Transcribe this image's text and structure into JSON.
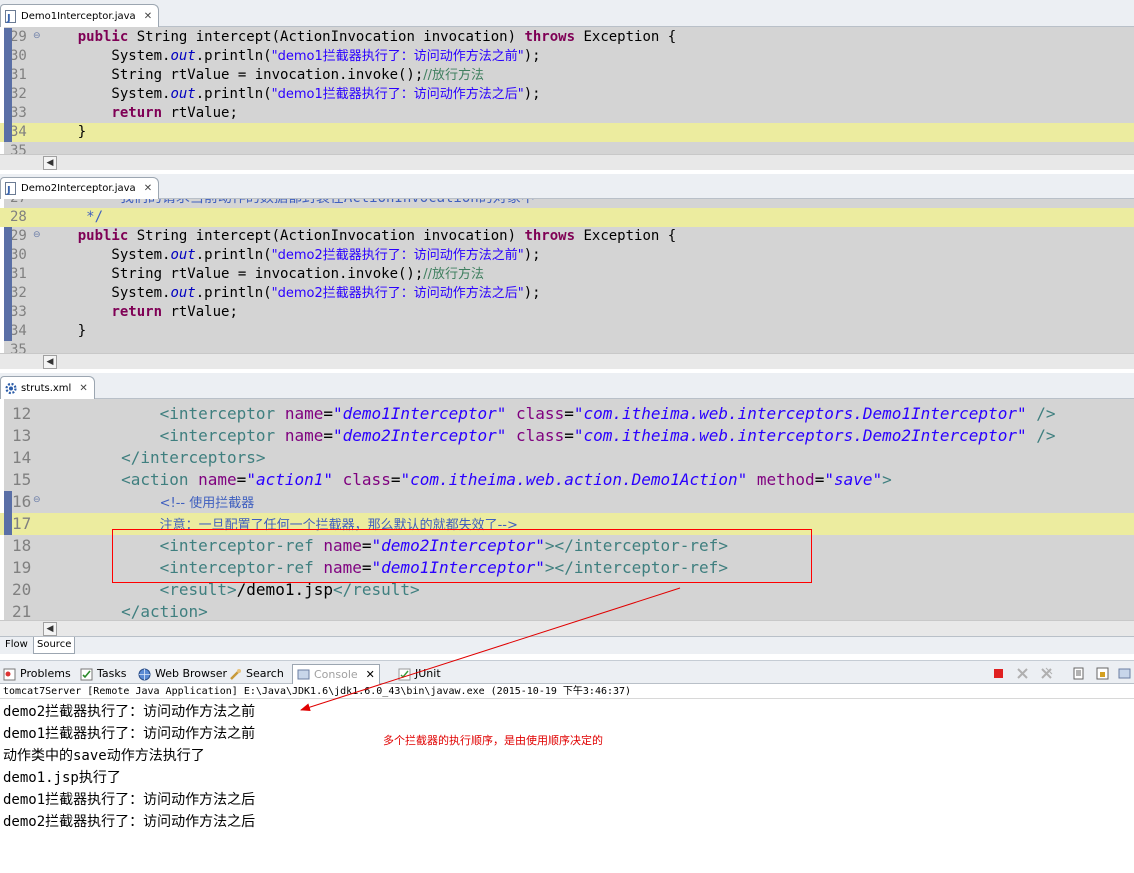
{
  "pane1": {
    "tab_label": "Demo1Interceptor.java",
    "lines": [
      {
        "n": "29",
        "segs": [
          [
            "p",
            "    "
          ],
          [
            "kw",
            "public"
          ],
          [
            "p",
            " String intercept(ActionInvocation invocation) "
          ],
          [
            "kw",
            "throws"
          ],
          [
            "p",
            " Exception {"
          ]
        ]
      },
      {
        "n": "30",
        "segs": [
          [
            "p",
            "        System."
          ],
          [
            "fld",
            "out"
          ],
          [
            "p",
            ".println("
          ],
          [
            "str",
            "\"demo1拦截器执行了：访问动作方法之前\""
          ],
          [
            "p",
            ");"
          ]
        ]
      },
      {
        "n": "31",
        "segs": [
          [
            "p",
            "        String rtValue = invocation.invoke();"
          ],
          [
            "cm",
            "//放行方法"
          ]
        ]
      },
      {
        "n": "32",
        "segs": [
          [
            "p",
            "        System."
          ],
          [
            "fld",
            "out"
          ],
          [
            "p",
            ".println("
          ],
          [
            "str",
            "\"demo1拦截器执行了：访问动作方法之后\""
          ],
          [
            "p",
            ");"
          ]
        ]
      },
      {
        "n": "33",
        "segs": [
          [
            "p",
            "        "
          ],
          [
            "kw",
            "return"
          ],
          [
            "p",
            " rtValue;"
          ]
        ]
      },
      {
        "n": "34",
        "segs": [
          [
            "p",
            "    }"
          ]
        ]
      },
      {
        "n": "35",
        "segs": [
          [
            "p",
            ""
          ]
        ]
      }
    ]
  },
  "pane2": {
    "tab_label": "Demo2Interceptor.java",
    "lines": [
      {
        "n": "27",
        "segs": [
          [
            "jd",
            "       * 我们的请求当前动作的数据都封装在ActionInvocation的对象中"
          ]
        ]
      },
      {
        "n": "28",
        "segs": [
          [
            "jd",
            "     */"
          ]
        ]
      },
      {
        "n": "29",
        "segs": [
          [
            "p",
            "    "
          ],
          [
            "kw",
            "public"
          ],
          [
            "p",
            " String intercept(ActionInvocation invocation) "
          ],
          [
            "kw",
            "throws"
          ],
          [
            "p",
            " Exception {"
          ]
        ]
      },
      {
        "n": "30",
        "segs": [
          [
            "p",
            "        System."
          ],
          [
            "fld",
            "out"
          ],
          [
            "p",
            ".println("
          ],
          [
            "str",
            "\"demo2拦截器执行了：访问动作方法之前\""
          ],
          [
            "p",
            ");"
          ]
        ]
      },
      {
        "n": "31",
        "segs": [
          [
            "p",
            "        String rtValue = invocation.invoke();"
          ],
          [
            "cm",
            "//放行方法"
          ]
        ]
      },
      {
        "n": "32",
        "segs": [
          [
            "p",
            "        System."
          ],
          [
            "fld",
            "out"
          ],
          [
            "p",
            ".println("
          ],
          [
            "str",
            "\"demo2拦截器执行了：访问动作方法之后\""
          ],
          [
            "p",
            ");"
          ]
        ]
      },
      {
        "n": "33",
        "segs": [
          [
            "p",
            "        "
          ],
          [
            "kw",
            "return"
          ],
          [
            "p",
            " rtValue;"
          ]
        ]
      },
      {
        "n": "34",
        "segs": [
          [
            "p",
            "    }"
          ]
        ]
      },
      {
        "n": "35",
        "segs": [
          [
            "p",
            ""
          ]
        ]
      }
    ]
  },
  "pane3": {
    "tab_label": "struts.xml",
    "lines": [
      {
        "n": "12",
        "segs": [
          [
            "p",
            "            "
          ],
          [
            "tag",
            "<interceptor"
          ],
          [
            "p",
            " "
          ],
          [
            "attr",
            "name"
          ],
          [
            "p",
            "="
          ],
          [
            "aval",
            "\"demo1Interceptor\""
          ],
          [
            "p",
            " "
          ],
          [
            "attr",
            "class"
          ],
          [
            "p",
            "="
          ],
          [
            "aval",
            "\"com.itheima.web.interceptors.Demo1Interceptor\""
          ],
          [
            "p",
            " "
          ],
          [
            "tag",
            "/>"
          ]
        ]
      },
      {
        "n": "13",
        "segs": [
          [
            "p",
            "            "
          ],
          [
            "tag",
            "<interceptor"
          ],
          [
            "p",
            " "
          ],
          [
            "attr",
            "name"
          ],
          [
            "p",
            "="
          ],
          [
            "aval",
            "\"demo2Interceptor\""
          ],
          [
            "p",
            " "
          ],
          [
            "attr",
            "class"
          ],
          [
            "p",
            "="
          ],
          [
            "aval",
            "\"com.itheima.web.interceptors.Demo2Interceptor\""
          ],
          [
            "p",
            " "
          ],
          [
            "tag",
            "/>"
          ]
        ]
      },
      {
        "n": "14",
        "segs": [
          [
            "p",
            "        "
          ],
          [
            "tag",
            "</interceptors>"
          ]
        ]
      },
      {
        "n": "15",
        "segs": [
          [
            "p",
            "        "
          ],
          [
            "tag",
            "<action"
          ],
          [
            "p",
            " "
          ],
          [
            "attr",
            "name"
          ],
          [
            "p",
            "="
          ],
          [
            "aval",
            "\"action1\""
          ],
          [
            "p",
            " "
          ],
          [
            "attr",
            "class"
          ],
          [
            "p",
            "="
          ],
          [
            "aval",
            "\"com.itheima.web.action.Demo1Action\""
          ],
          [
            "p",
            " "
          ],
          [
            "attr",
            "method"
          ],
          [
            "p",
            "="
          ],
          [
            "aval",
            "\"save\""
          ],
          [
            "tag",
            ">"
          ]
        ]
      },
      {
        "n": "16",
        "segs": [
          [
            "p",
            "            "
          ],
          [
            "xcm",
            "<!-- 使用拦截器"
          ]
        ]
      },
      {
        "n": "17",
        "segs": [
          [
            "p",
            "            "
          ],
          [
            "xcm",
            "注意：一旦配置了任何一个拦截器，那么默认的就都失效了-->"
          ]
        ]
      },
      {
        "n": "18",
        "segs": [
          [
            "p",
            "            "
          ],
          [
            "tag",
            "<interceptor-ref"
          ],
          [
            "p",
            " "
          ],
          [
            "attr",
            "name"
          ],
          [
            "p",
            "="
          ],
          [
            "aval",
            "\"demo2Interceptor\""
          ],
          [
            "tag",
            "></interceptor-ref>"
          ]
        ]
      },
      {
        "n": "19",
        "segs": [
          [
            "p",
            "            "
          ],
          [
            "tag",
            "<interceptor-ref"
          ],
          [
            "p",
            " "
          ],
          [
            "attr",
            "name"
          ],
          [
            "p",
            "="
          ],
          [
            "aval",
            "\"demo1Interceptor\""
          ],
          [
            "tag",
            "></interceptor-ref>"
          ]
        ]
      },
      {
        "n": "20",
        "segs": [
          [
            "p",
            "            "
          ],
          [
            "tag",
            "<result>"
          ],
          [
            "p",
            "/demo1.jsp"
          ],
          [
            "tag",
            "</result>"
          ]
        ]
      },
      {
        "n": "21",
        "segs": [
          [
            "p",
            "        "
          ],
          [
            "tag",
            "</action>"
          ]
        ]
      }
    ],
    "mode_tabs": [
      "Flow",
      "Source"
    ]
  },
  "views": {
    "tabs": [
      {
        "label": "Problems",
        "icon": "problems-icon"
      },
      {
        "label": "Tasks",
        "icon": "tasks-icon"
      },
      {
        "label": "Web Browser",
        "icon": "web-browser-icon"
      },
      {
        "label": "Search",
        "icon": "search-icon"
      },
      {
        "label": "Console",
        "icon": "console-icon"
      },
      {
        "label": "JUnit",
        "icon": "junit-icon"
      }
    ]
  },
  "console": {
    "header": "tomcat7Server [Remote Java Application] E:\\Java\\JDK1.6\\jdk1.6.0_43\\bin\\javaw.exe (2015-10-19 下午3:46:37)",
    "lines": [
      "demo2拦截器执行了：访问动作方法之前",
      "demo1拦截器执行了：访问动作方法之前",
      "动作类中的save动作方法执行了",
      "demo1.jsp执行了",
      "demo1拦截器执行了：访问动作方法之后",
      "demo2拦截器执行了：访问动作方法之后"
    ]
  },
  "annotation": {
    "note": "多个拦截器的执行顺序，是由使用顺序决定的",
    "color": "#e00000"
  }
}
